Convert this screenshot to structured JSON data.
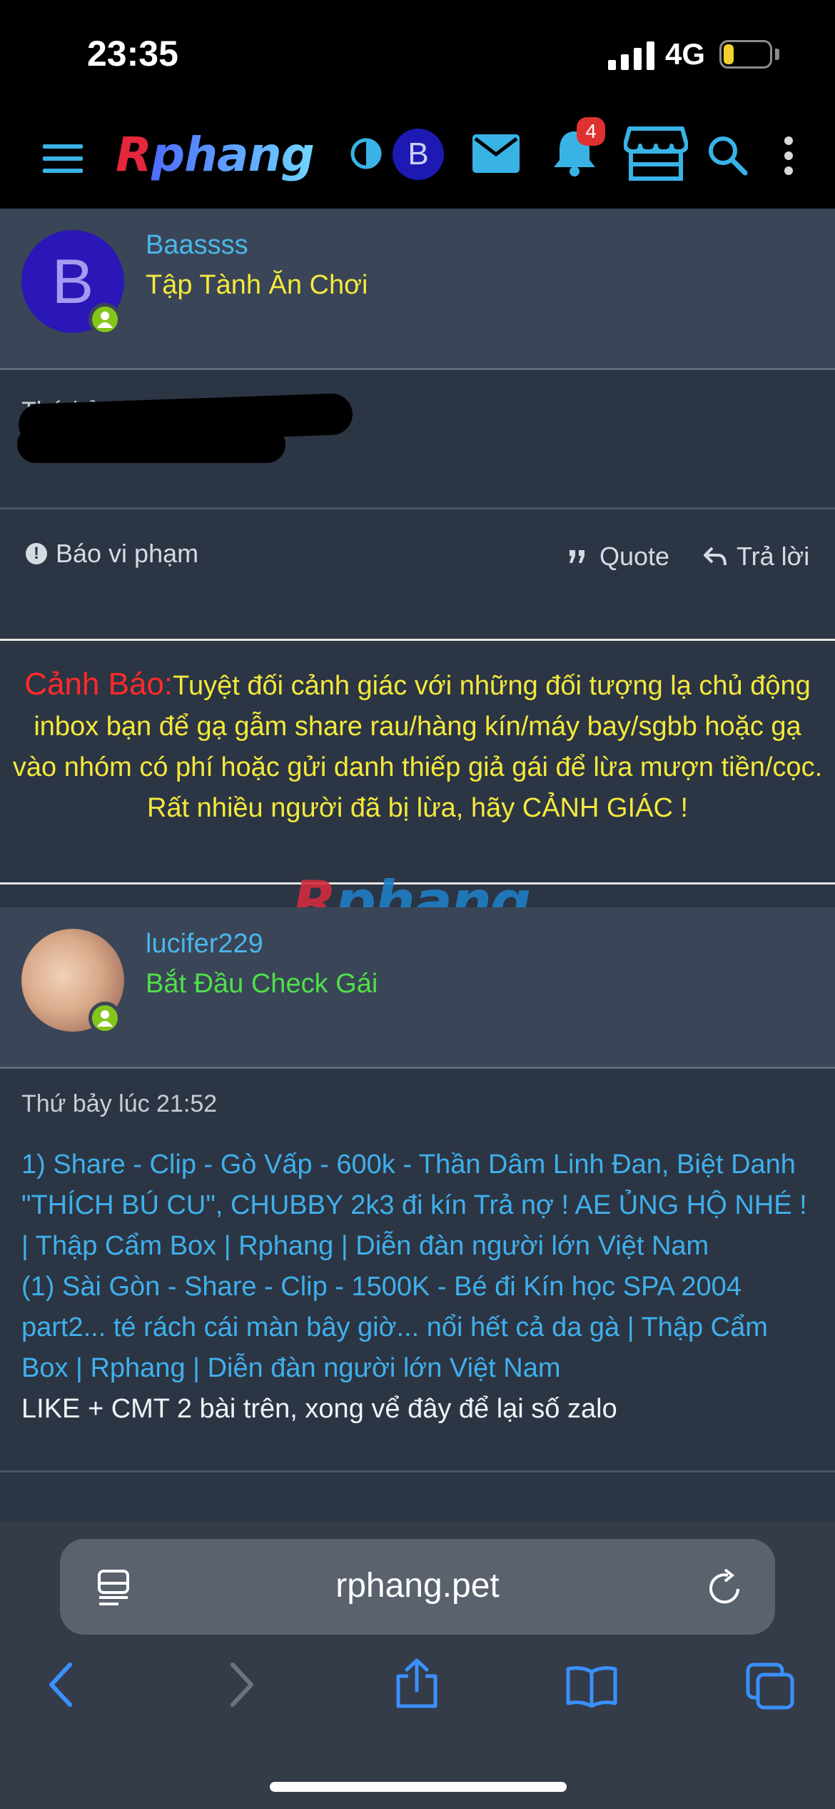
{
  "status_bar": {
    "time": "23:35",
    "network": "4G",
    "battery": "15"
  },
  "header": {
    "logo_r": "R",
    "logo_rest": "phang",
    "avatar_letter": "B",
    "notification_count": "4"
  },
  "posts": [
    {
      "username": "Baassss",
      "user_title": "Tập Tành Ăn Chơi",
      "user_title_color": "#f4e93c",
      "avatar_letter": "B",
      "time": "Thứ bảy lúc 21:15",
      "report_label": "Báo vi phạm",
      "quote_label": "Quote",
      "reply_label": "Trả lời"
    },
    {
      "username": "lucifer229",
      "user_title": "Bắt Đầu Check Gái",
      "user_title_color": "#4fe04a",
      "time": "Thứ bảy lúc 21:52",
      "links": [
        "1) Share - Clip - Gò Vấp - 600k - Thần Dâm Linh Đan, Biệt Danh \"THÍCH BÚ CU\", CHUBBY 2k3 đi kín Trả nợ ! AE ỦNG HỘ NHÉ ! | Thập Cẩm Box | Rphang | Diễn đàn người lớn Việt Nam",
        "(1) Sài Gòn - Share - Clip - 1500K - Bé đi Kín học SPA 2004 part2... té rách cái màn bây giờ... nổi hết cả da gà | Thập Cẩm Box | Rphang | Diễn đàn người lớn Việt Nam"
      ],
      "text": "LIKE + CMT 2 bài trên, xong vể đây để lại số zalo"
    }
  ],
  "warning": {
    "label": "Cảnh Báo:",
    "text": "Tuyệt đối cảnh giác với những đối tượng lạ chủ động inbox bạn để gạ gẫm share rau/hàng kín/máy bay/sgbb hoặc gạ vào nhóm có phí hoặc gửi danh thiếp giả gái để lừa mượn tiền/cọc.",
    "line2": "Rất nhiều người đã bị lừa, hãy CẢNH GIÁC !"
  },
  "watermark": {
    "r": "R",
    "rest": "phang"
  },
  "browser": {
    "url": "rphang.pet"
  },
  "colors": {
    "accent_blue": "#4bb6ea",
    "warning_red": "#ff2a2a",
    "warning_yellow": "#f4e93c",
    "online_green": "#84c51a"
  },
  "icons": [
    "menu-icon",
    "contrast-icon",
    "mail-icon",
    "bell-icon",
    "store-icon",
    "search-icon",
    "more-icon",
    "report-icon",
    "quote-icon",
    "reply-icon",
    "reader-icon",
    "reload-icon",
    "back-icon",
    "forward-icon",
    "share-icon",
    "bookmarks-icon",
    "tabs-icon"
  ]
}
